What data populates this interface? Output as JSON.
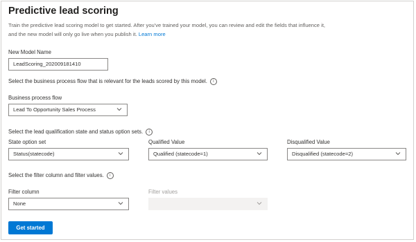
{
  "header": {
    "title": "Predictive lead scoring",
    "description": "Train the predictive lead scoring model to get started. After you've trained your model, you can review and edit the fields that influence it, and the new model will only go live when you publish it.",
    "learn_more": "Learn more"
  },
  "model_name": {
    "label": "New Model Name",
    "value": "LeadScoring_202009181410"
  },
  "bpf_section": {
    "heading": "Select the business process flow that is relevant for the leads scored by this model.",
    "field_label": "Business process flow",
    "value": "Lead To Opportunity Sales Process"
  },
  "state_section": {
    "heading": "Select the lead qualification state and status option sets.",
    "state_label": "State option set",
    "state_value": "Status(statecode)",
    "qualified_label": "Qualified Value",
    "qualified_value": "Qualified (statecode=1)",
    "disqualified_label": "Disqualified Value",
    "disqualified_value": "Disqualified (statecode=2)"
  },
  "filter_section": {
    "heading": "Select the filter column and filter values.",
    "column_label": "Filter column",
    "column_value": "None",
    "values_label": "Filter values",
    "values_value": ""
  },
  "actions": {
    "get_started": "Get started"
  },
  "colors": {
    "accent": "#0078d4",
    "border": "#8a8886",
    "disabled_bg": "#f3f2f1"
  },
  "icons": {
    "info": "info-circle-icon",
    "chevron": "chevron-down-icon"
  }
}
